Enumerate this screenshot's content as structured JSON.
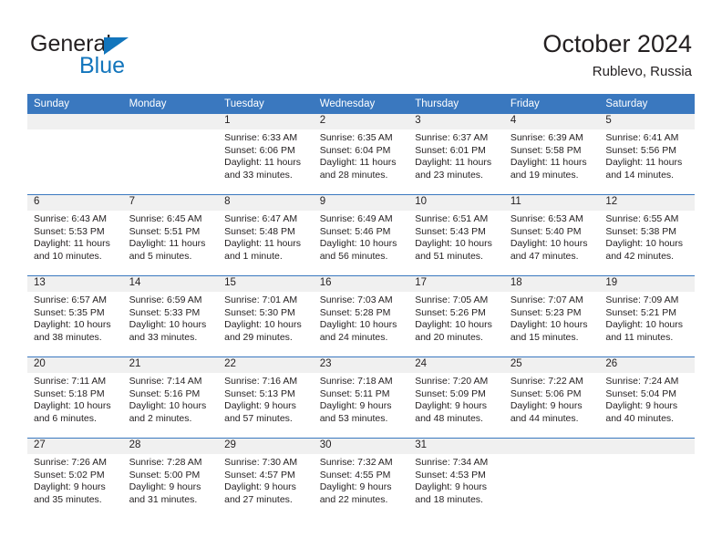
{
  "brand": {
    "line1": "General",
    "line2": "Blue",
    "mark": "triangle-icon"
  },
  "header": {
    "title": "October 2024",
    "subtitle": "Rublevo, Russia"
  },
  "colors": {
    "header_blue": "#3a78bf",
    "brand_blue": "#1275bc",
    "date_band": "#f0f0f0",
    "text": "#231f20"
  },
  "calendar": {
    "weekday_headers": [
      "Sunday",
      "Monday",
      "Tuesday",
      "Wednesday",
      "Thursday",
      "Friday",
      "Saturday"
    ],
    "labels": {
      "sunrise": "Sunrise:",
      "sunset": "Sunset:",
      "daylight": "Daylight:"
    },
    "weeks": [
      [
        {
          "date": "",
          "sunrise": "",
          "sunset": "",
          "daylight_1": "",
          "daylight_2": ""
        },
        {
          "date": "",
          "sunrise": "",
          "sunset": "",
          "daylight_1": "",
          "daylight_2": ""
        },
        {
          "date": "1",
          "sunrise": "Sunrise: 6:33 AM",
          "sunset": "Sunset: 6:06 PM",
          "daylight_1": "Daylight: 11 hours",
          "daylight_2": "and 33 minutes."
        },
        {
          "date": "2",
          "sunrise": "Sunrise: 6:35 AM",
          "sunset": "Sunset: 6:04 PM",
          "daylight_1": "Daylight: 11 hours",
          "daylight_2": "and 28 minutes."
        },
        {
          "date": "3",
          "sunrise": "Sunrise: 6:37 AM",
          "sunset": "Sunset: 6:01 PM",
          "daylight_1": "Daylight: 11 hours",
          "daylight_2": "and 23 minutes."
        },
        {
          "date": "4",
          "sunrise": "Sunrise: 6:39 AM",
          "sunset": "Sunset: 5:58 PM",
          "daylight_1": "Daylight: 11 hours",
          "daylight_2": "and 19 minutes."
        },
        {
          "date": "5",
          "sunrise": "Sunrise: 6:41 AM",
          "sunset": "Sunset: 5:56 PM",
          "daylight_1": "Daylight: 11 hours",
          "daylight_2": "and 14 minutes."
        }
      ],
      [
        {
          "date": "6",
          "sunrise": "Sunrise: 6:43 AM",
          "sunset": "Sunset: 5:53 PM",
          "daylight_1": "Daylight: 11 hours",
          "daylight_2": "and 10 minutes."
        },
        {
          "date": "7",
          "sunrise": "Sunrise: 6:45 AM",
          "sunset": "Sunset: 5:51 PM",
          "daylight_1": "Daylight: 11 hours",
          "daylight_2": "and 5 minutes."
        },
        {
          "date": "8",
          "sunrise": "Sunrise: 6:47 AM",
          "sunset": "Sunset: 5:48 PM",
          "daylight_1": "Daylight: 11 hours",
          "daylight_2": "and 1 minute."
        },
        {
          "date": "9",
          "sunrise": "Sunrise: 6:49 AM",
          "sunset": "Sunset: 5:46 PM",
          "daylight_1": "Daylight: 10 hours",
          "daylight_2": "and 56 minutes."
        },
        {
          "date": "10",
          "sunrise": "Sunrise: 6:51 AM",
          "sunset": "Sunset: 5:43 PM",
          "daylight_1": "Daylight: 10 hours",
          "daylight_2": "and 51 minutes."
        },
        {
          "date": "11",
          "sunrise": "Sunrise: 6:53 AM",
          "sunset": "Sunset: 5:40 PM",
          "daylight_1": "Daylight: 10 hours",
          "daylight_2": "and 47 minutes."
        },
        {
          "date": "12",
          "sunrise": "Sunrise: 6:55 AM",
          "sunset": "Sunset: 5:38 PM",
          "daylight_1": "Daylight: 10 hours",
          "daylight_2": "and 42 minutes."
        }
      ],
      [
        {
          "date": "13",
          "sunrise": "Sunrise: 6:57 AM",
          "sunset": "Sunset: 5:35 PM",
          "daylight_1": "Daylight: 10 hours",
          "daylight_2": "and 38 minutes."
        },
        {
          "date": "14",
          "sunrise": "Sunrise: 6:59 AM",
          "sunset": "Sunset: 5:33 PM",
          "daylight_1": "Daylight: 10 hours",
          "daylight_2": "and 33 minutes."
        },
        {
          "date": "15",
          "sunrise": "Sunrise: 7:01 AM",
          "sunset": "Sunset: 5:30 PM",
          "daylight_1": "Daylight: 10 hours",
          "daylight_2": "and 29 minutes."
        },
        {
          "date": "16",
          "sunrise": "Sunrise: 7:03 AM",
          "sunset": "Sunset: 5:28 PM",
          "daylight_1": "Daylight: 10 hours",
          "daylight_2": "and 24 minutes."
        },
        {
          "date": "17",
          "sunrise": "Sunrise: 7:05 AM",
          "sunset": "Sunset: 5:26 PM",
          "daylight_1": "Daylight: 10 hours",
          "daylight_2": "and 20 minutes."
        },
        {
          "date": "18",
          "sunrise": "Sunrise: 7:07 AM",
          "sunset": "Sunset: 5:23 PM",
          "daylight_1": "Daylight: 10 hours",
          "daylight_2": "and 15 minutes."
        },
        {
          "date": "19",
          "sunrise": "Sunrise: 7:09 AM",
          "sunset": "Sunset: 5:21 PM",
          "daylight_1": "Daylight: 10 hours",
          "daylight_2": "and 11 minutes."
        }
      ],
      [
        {
          "date": "20",
          "sunrise": "Sunrise: 7:11 AM",
          "sunset": "Sunset: 5:18 PM",
          "daylight_1": "Daylight: 10 hours",
          "daylight_2": "and 6 minutes."
        },
        {
          "date": "21",
          "sunrise": "Sunrise: 7:14 AM",
          "sunset": "Sunset: 5:16 PM",
          "daylight_1": "Daylight: 10 hours",
          "daylight_2": "and 2 minutes."
        },
        {
          "date": "22",
          "sunrise": "Sunrise: 7:16 AM",
          "sunset": "Sunset: 5:13 PM",
          "daylight_1": "Daylight: 9 hours",
          "daylight_2": "and 57 minutes."
        },
        {
          "date": "23",
          "sunrise": "Sunrise: 7:18 AM",
          "sunset": "Sunset: 5:11 PM",
          "daylight_1": "Daylight: 9 hours",
          "daylight_2": "and 53 minutes."
        },
        {
          "date": "24",
          "sunrise": "Sunrise: 7:20 AM",
          "sunset": "Sunset: 5:09 PM",
          "daylight_1": "Daylight: 9 hours",
          "daylight_2": "and 48 minutes."
        },
        {
          "date": "25",
          "sunrise": "Sunrise: 7:22 AM",
          "sunset": "Sunset: 5:06 PM",
          "daylight_1": "Daylight: 9 hours",
          "daylight_2": "and 44 minutes."
        },
        {
          "date": "26",
          "sunrise": "Sunrise: 7:24 AM",
          "sunset": "Sunset: 5:04 PM",
          "daylight_1": "Daylight: 9 hours",
          "daylight_2": "and 40 minutes."
        }
      ],
      [
        {
          "date": "27",
          "sunrise": "Sunrise: 7:26 AM",
          "sunset": "Sunset: 5:02 PM",
          "daylight_1": "Daylight: 9 hours",
          "daylight_2": "and 35 minutes."
        },
        {
          "date": "28",
          "sunrise": "Sunrise: 7:28 AM",
          "sunset": "Sunset: 5:00 PM",
          "daylight_1": "Daylight: 9 hours",
          "daylight_2": "and 31 minutes."
        },
        {
          "date": "29",
          "sunrise": "Sunrise: 7:30 AM",
          "sunset": "Sunset: 4:57 PM",
          "daylight_1": "Daylight: 9 hours",
          "daylight_2": "and 27 minutes."
        },
        {
          "date": "30",
          "sunrise": "Sunrise: 7:32 AM",
          "sunset": "Sunset: 4:55 PM",
          "daylight_1": "Daylight: 9 hours",
          "daylight_2": "and 22 minutes."
        },
        {
          "date": "31",
          "sunrise": "Sunrise: 7:34 AM",
          "sunset": "Sunset: 4:53 PM",
          "daylight_1": "Daylight: 9 hours",
          "daylight_2": "and 18 minutes."
        },
        {
          "date": "",
          "sunrise": "",
          "sunset": "",
          "daylight_1": "",
          "daylight_2": ""
        },
        {
          "date": "",
          "sunrise": "",
          "sunset": "",
          "daylight_1": "",
          "daylight_2": ""
        }
      ]
    ]
  }
}
